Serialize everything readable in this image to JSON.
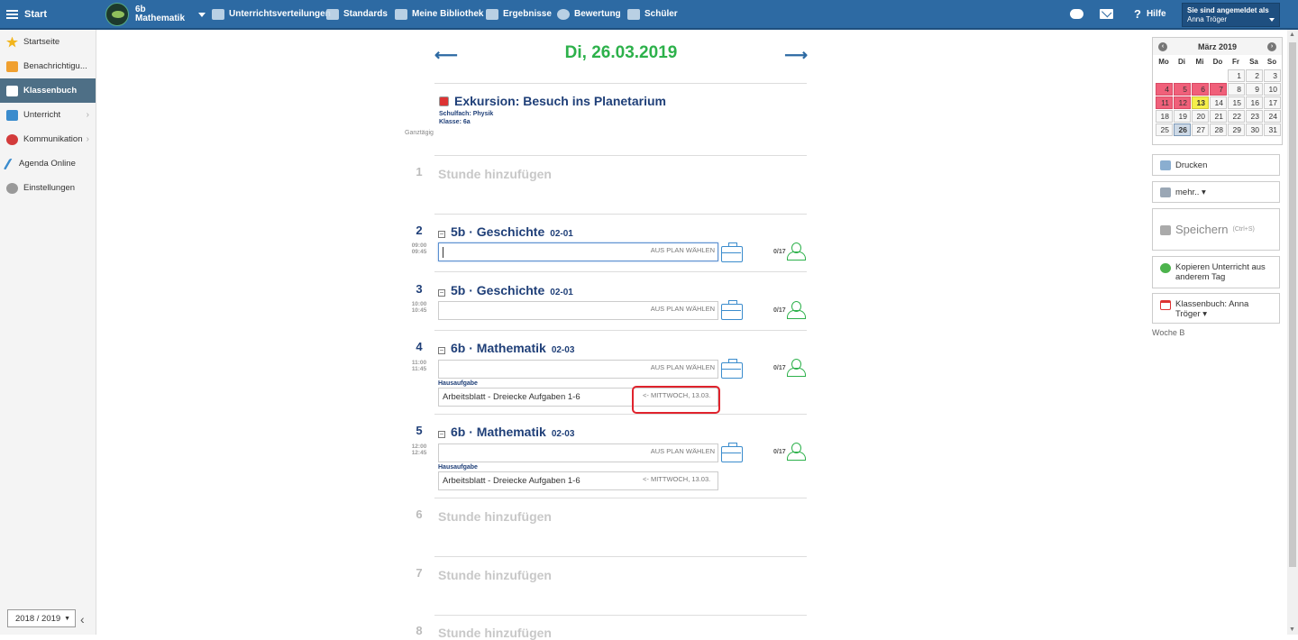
{
  "topbar": {
    "start_label": "Start",
    "class_line1": "6b",
    "class_line2": "Mathematik",
    "nav": [
      {
        "label": "Unterrichtsverteilungen",
        "icon": "table-icon"
      },
      {
        "label": "Standards",
        "icon": "shield-icon"
      },
      {
        "label": "Meine Bibliothek",
        "icon": "library-icon"
      },
      {
        "label": "Ergebnisse",
        "icon": "bar-chart-icon"
      },
      {
        "label": "Bewertung",
        "icon": "grade-icon"
      },
      {
        "label": "Schüler",
        "icon": "students-icon"
      }
    ],
    "help_label": "Hilfe",
    "user_caption": "Sie sind angemeldet als",
    "user_name": "Anna Tröger"
  },
  "sidebar": {
    "items": [
      {
        "label": "Startseite",
        "icon": "star-icon",
        "color": "#f2b51c"
      },
      {
        "label": "Benachrichtigu...",
        "icon": "envelope-icon",
        "color": "#f0a030"
      },
      {
        "label": "Klassenbuch",
        "icon": "book-icon",
        "color": "#ffffff"
      },
      {
        "label": "Unterricht",
        "icon": "briefcase-icon",
        "color": "#3b8ccd"
      },
      {
        "label": "Kommunikation",
        "icon": "chat-icon",
        "color": "#d33b3b"
      },
      {
        "label": "Agenda Online",
        "icon": "pen-icon",
        "color": "#3b8ccd"
      },
      {
        "label": "Einstellungen",
        "icon": "gear-icon",
        "color": "#999999"
      }
    ],
    "year": "2018 / 2019"
  },
  "day": {
    "title": "Di, 26.03.2019",
    "excursion_title": "Exkursion: Besuch ins Planetarium",
    "excursion_subject": "Schulfach:  Physik",
    "excursion_class": "Klasse:  6a",
    "all_day": "Ganztägig"
  },
  "periods": [
    {
      "num": "1",
      "add": "Stunde hinzufügen"
    },
    {
      "num": "2",
      "t1": "09:00",
      "t2": "09:45",
      "title": "5b · Geschichte",
      "room": "02-01",
      "plan": "AUS PLAN WÄHLEN",
      "count": "0/17"
    },
    {
      "num": "3",
      "t1": "10:00",
      "t2": "10:45",
      "title": "5b · Geschichte",
      "room": "02-01",
      "plan": "AUS PLAN WÄHLEN",
      "count": "0/17"
    },
    {
      "num": "4",
      "t1": "11:00",
      "t2": "11:45",
      "title": "6b · Mathematik",
      "room": "02-03",
      "plan": "AUS PLAN WÄHLEN",
      "count": "0/17",
      "hw_label": "Hausaufgabe",
      "hw": "Arbeitsblatt - Dreiecke Aufgaben 1-6",
      "due": "<- MITTWOCH, 13.03."
    },
    {
      "num": "5",
      "t1": "12:00",
      "t2": "12:45",
      "title": "6b · Mathematik",
      "room": "02-03",
      "plan": "AUS PLAN WÄHLEN",
      "count": "0/17",
      "hw_label": "Hausaufgabe",
      "hw": "Arbeitsblatt - Dreiecke Aufgaben 1-6",
      "due": "<- MITTWOCH, 13.03."
    },
    {
      "num": "6",
      "add": "Stunde hinzufügen"
    },
    {
      "num": "7",
      "add": "Stunde hinzufügen"
    },
    {
      "num": "8",
      "add": "Stunde hinzufügen"
    }
  ],
  "calendar": {
    "month": "März 2019",
    "dow": [
      "Mo",
      "Di",
      "Mi",
      "Do",
      "Fr",
      "Sa",
      "So"
    ],
    "colors": {
      "holiday": "#f0607a",
      "today_marker": "#f5ef4a",
      "selected": "#cdd9e6"
    }
  },
  "right": {
    "print": "Drucken",
    "more": "mehr.. ▾",
    "save": "Speichern",
    "save_hint": "(Ctrl+S)",
    "copy": "Kopieren Unterricht aus anderem Tag",
    "book": "Klassenbuch: Anna Tröger ▾",
    "week": "Woche B"
  },
  "accent": {
    "primary": "#2d6aa3",
    "green": "#2db14b",
    "navy": "#1f3f78"
  }
}
